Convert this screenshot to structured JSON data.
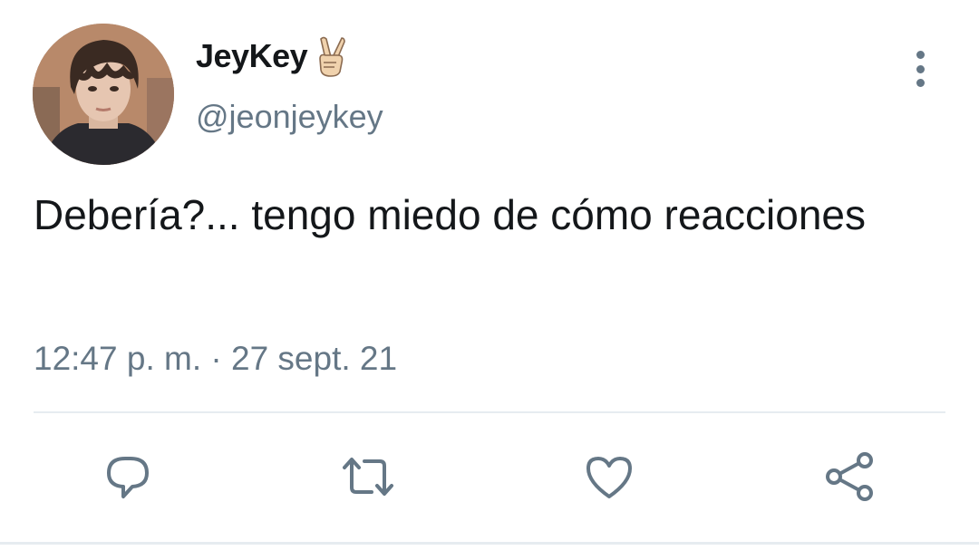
{
  "tweet": {
    "display_name": "JeyKey",
    "handle": "@jeonjeykey",
    "emoji_icon": "victory-hand-icon",
    "text": "Debería?... tengo miedo de cómo reacciones",
    "timestamp": "12:47 p. m. · 27 sept. 21"
  },
  "actions": {
    "reply_icon": "reply-icon",
    "retweet_icon": "retweet-icon",
    "like_icon": "heart-icon",
    "share_icon": "share-icon"
  },
  "colors": {
    "text_primary": "#14171a",
    "text_secondary": "#657786",
    "divider": "#e6ecf0"
  }
}
